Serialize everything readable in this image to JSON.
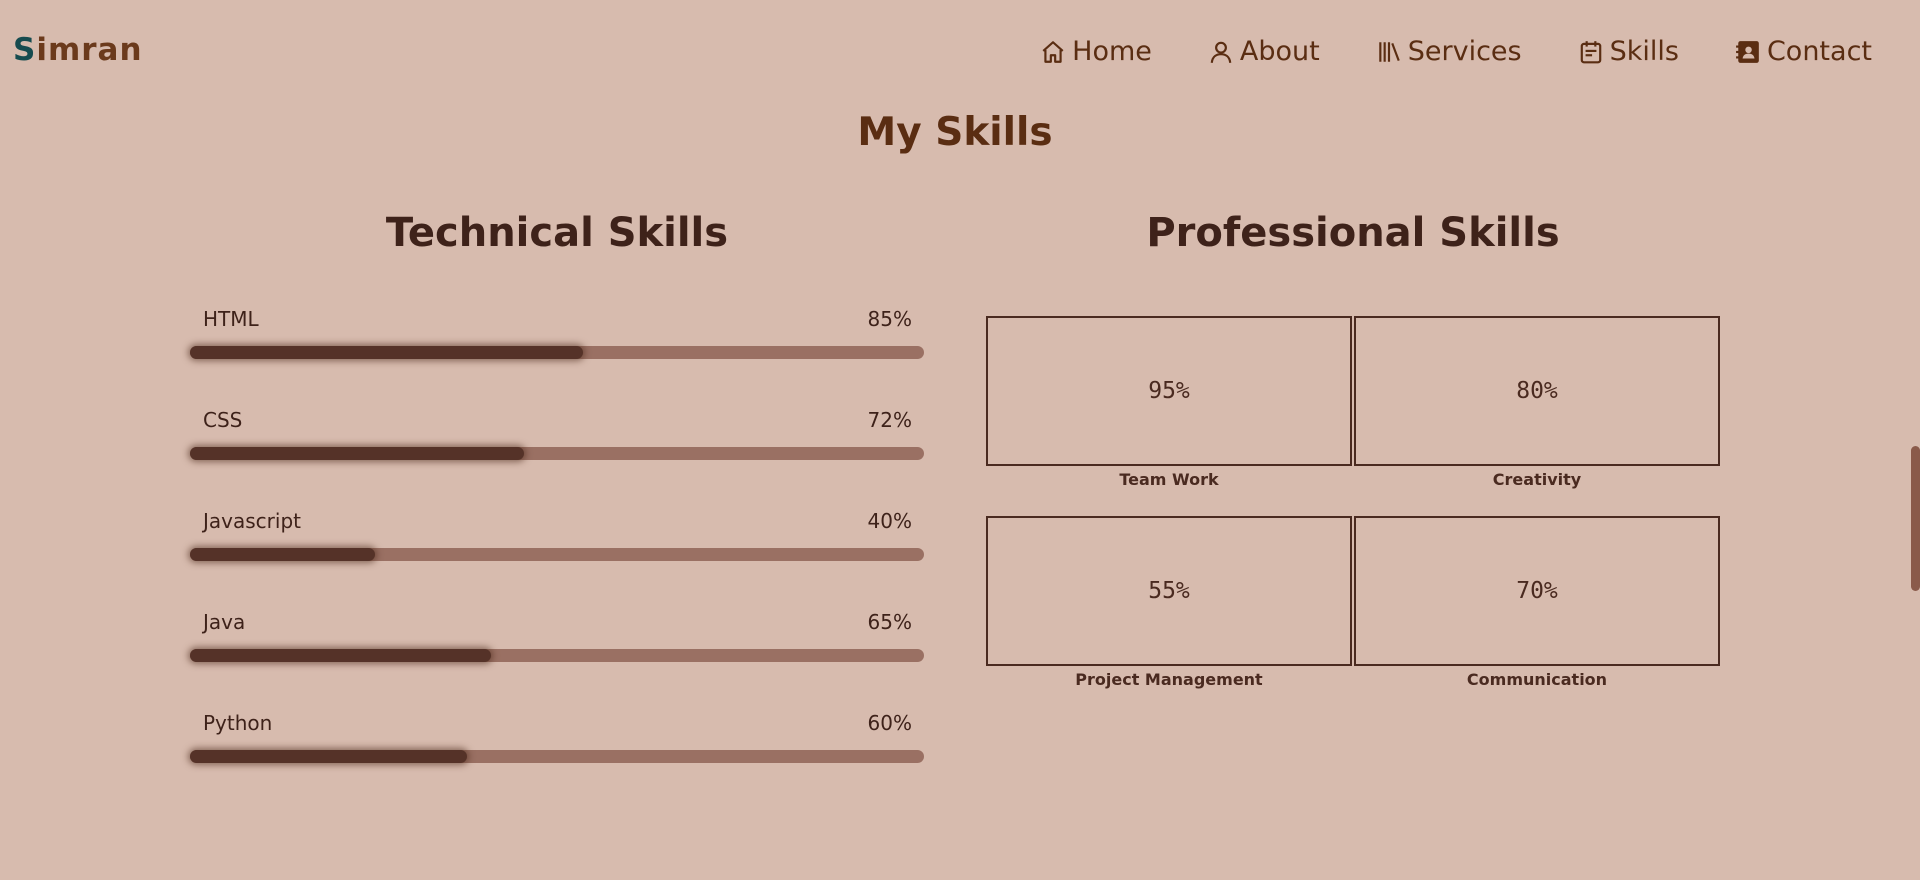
{
  "header": {
    "logo_first": "S",
    "logo_rest": "imran",
    "nav": [
      {
        "label": "Home",
        "icon": "home-icon"
      },
      {
        "label": "About",
        "icon": "user-icon"
      },
      {
        "label": "Services",
        "icon": "books-icon"
      },
      {
        "label": "Skills",
        "icon": "calendar-icon"
      },
      {
        "label": "Contact",
        "icon": "contact-book-icon"
      }
    ]
  },
  "main": {
    "title": "My Skills",
    "technical": {
      "title": "Technical Skills",
      "skills": [
        {
          "name": "HTML",
          "value_label": "85%",
          "fill": 0.535
        },
        {
          "name": "CSS",
          "value_label": "72%",
          "fill": 0.455
        },
        {
          "name": "Javascript",
          "value_label": "40%",
          "fill": 0.252
        },
        {
          "name": "Java",
          "value_label": "65%",
          "fill": 0.41
        },
        {
          "name": "Python",
          "value_label": "60%",
          "fill": 0.378
        }
      ]
    },
    "professional": {
      "title": "Professional Skills",
      "skills": [
        {
          "name": "Team Work",
          "value_label": "95%"
        },
        {
          "name": "Creativity",
          "value_label": "80%"
        },
        {
          "name": "Project Management",
          "value_label": "55%"
        },
        {
          "name": "Communication",
          "value_label": "70%"
        }
      ]
    }
  },
  "colors": {
    "background": "#d7bbae",
    "accent": "#5a2d12",
    "logo_first": "#164b4f",
    "bar_track": "#9a7063",
    "bar_fill": "#553228"
  }
}
